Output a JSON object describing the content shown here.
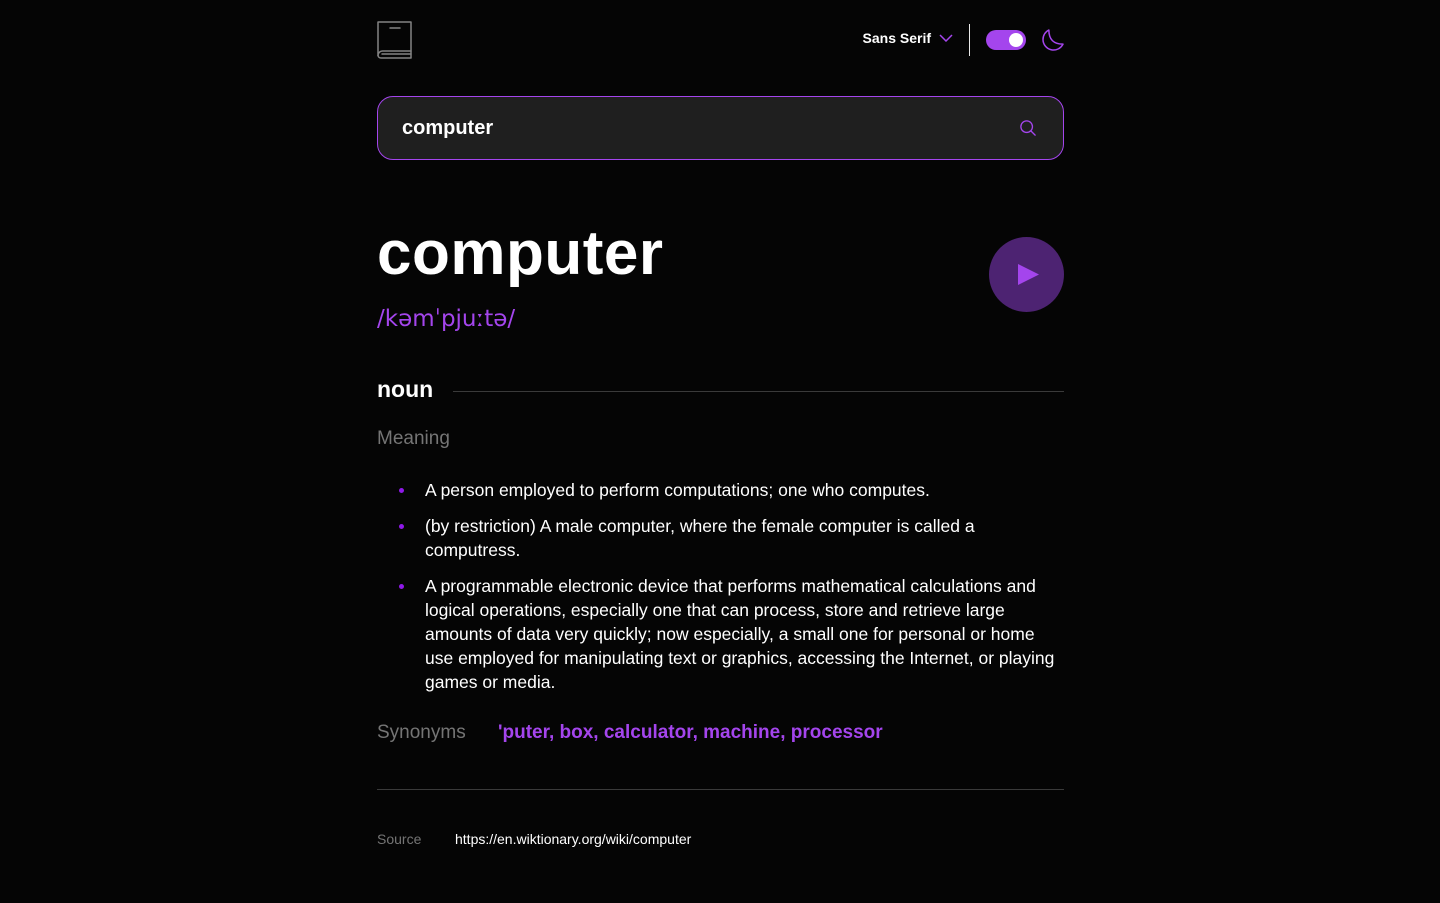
{
  "header": {
    "logo_icon": "book-icon",
    "font_selector": {
      "selected": "Sans Serif",
      "icon": "chevron-down-icon"
    },
    "theme_toggle": {
      "state": "on",
      "icon": "moon-icon"
    }
  },
  "search": {
    "value": "computer",
    "icon": "search-icon"
  },
  "entry": {
    "word": "computer",
    "phonetic": "/kəmˈpjuːtə/",
    "play_icon": "play-icon",
    "part_of_speech": "noun",
    "meaning_heading": "Meaning",
    "definitions": [
      "A person employed to perform computations; one who computes.",
      "(by restriction) A male computer, where the female computer is called a computress.",
      "A programmable electronic device that performs mathematical calculations and logical operations, especially one that can process, store and retrieve large amounts of data very quickly; now especially, a small one for personal or home use employed for manipulating text or graphics, accessing the Internet, or playing games or media."
    ],
    "synonyms_heading": "Synonyms",
    "synonyms_text": "'puter, box, calculator, machine, processor"
  },
  "source": {
    "label": "Source",
    "url": "https://en.wiktionary.org/wiki/computer"
  },
  "colors": {
    "background": "#050505",
    "accent": "#a445ed",
    "play_button_bg": "#4d2372",
    "search_bg": "#1f1f1f",
    "muted_text": "#757575"
  }
}
